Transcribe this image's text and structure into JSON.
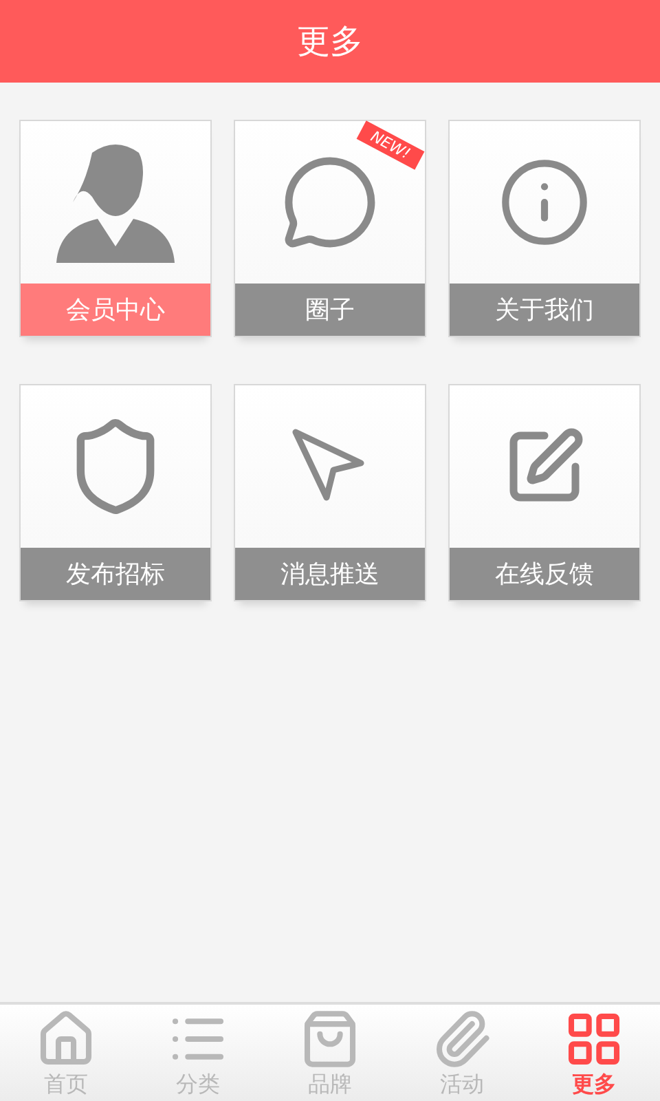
{
  "header": {
    "title": "更多"
  },
  "tiles": [
    {
      "label": "会员中心",
      "selected": true
    },
    {
      "label": "圈子",
      "selected": false,
      "badge": "NEW!"
    },
    {
      "label": "关于我们",
      "selected": false
    },
    {
      "label": "发布招标",
      "selected": false
    },
    {
      "label": "消息推送",
      "selected": false
    },
    {
      "label": "在线反馈",
      "selected": false
    }
  ],
  "tabs": [
    {
      "label": "首页",
      "selected": false
    },
    {
      "label": "分类",
      "selected": false
    },
    {
      "label": "品牌",
      "selected": false
    },
    {
      "label": "活动",
      "selected": false
    },
    {
      "label": "更多",
      "selected": true
    }
  ]
}
